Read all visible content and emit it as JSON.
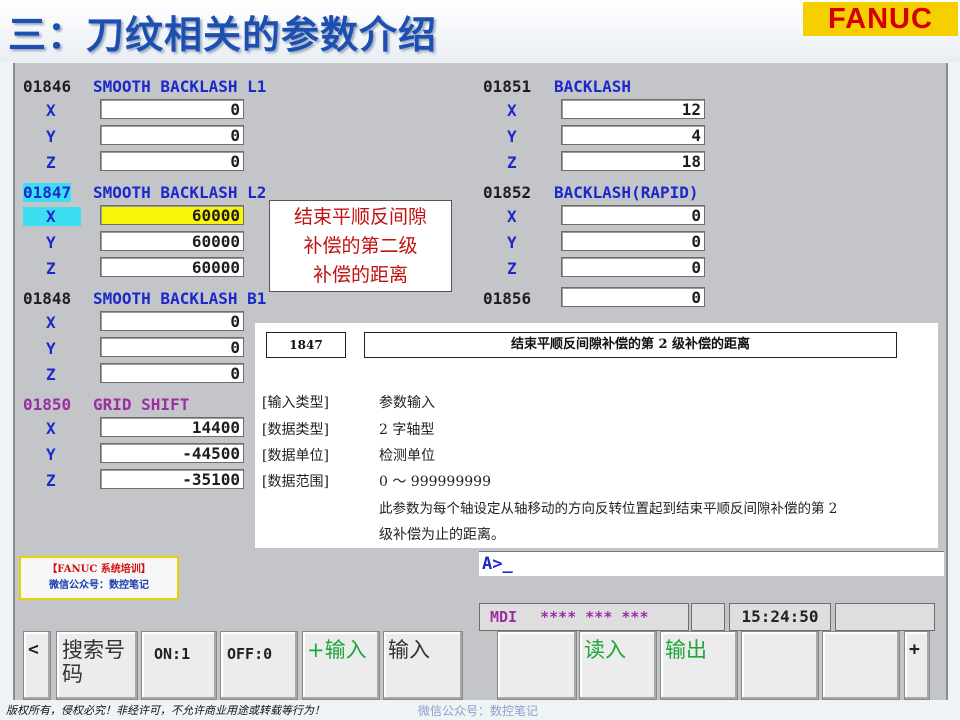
{
  "header": {
    "title": "三：刀纹相关的参数介绍",
    "logo": "FANUC"
  },
  "params": {
    "p1846": {
      "number": "01846",
      "name": "SMOOTH BACKLASH L1",
      "x": "0",
      "y": "0",
      "z": "0"
    },
    "p1847": {
      "number": "01847",
      "name": "SMOOTH BACKLASH L2",
      "x": "60000",
      "y": "60000",
      "z": "60000"
    },
    "p1848": {
      "number": "01848",
      "name": "SMOOTH BACKLASH B1",
      "x": "0",
      "y": "0",
      "z": "0"
    },
    "p1850": {
      "number": "01850",
      "name": "GRID SHIFT",
      "x": "14400",
      "y": "-44500",
      "z": "-35100"
    },
    "p1851": {
      "number": "01851",
      "name": "BACKLASH",
      "x": "12",
      "y": "4",
      "z": "18"
    },
    "p1852": {
      "number": "01852",
      "name": "BACKLASH(RAPID)",
      "x": "0",
      "y": "0",
      "z": "0"
    },
    "p1856": {
      "number": "01856",
      "value": "0"
    }
  },
  "axes": {
    "x": "X",
    "y": "Y",
    "z": "Z"
  },
  "note": {
    "line1": "结束平顺反间隙",
    "line2": "补偿的第二级",
    "line3": "补偿的距离"
  },
  "manual": {
    "param_no": "1847",
    "param_title": "结束平顺反间隙补偿的第 2 级补偿的距离",
    "rows": [
      {
        "label": "[输入类型]",
        "value": "参数输入"
      },
      {
        "label": "[数据类型]",
        "value": "2 字轴型"
      },
      {
        "label": "[数据单位]",
        "value": "检测单位"
      },
      {
        "label": "[数据范围]",
        "value": "0 ～ 999999999"
      }
    ],
    "desc1": "此参数为每个轴设定从轴移动的方向反转位置起到结束平顺反间隙补偿的第 2",
    "desc2": "级补偿为止的距离。"
  },
  "wechat_badge": {
    "line1": "【FANUC 系统培训】",
    "line2": "微信公众号：数控笔记"
  },
  "prompt": "A>_",
  "status": {
    "mode": "MDI",
    "stars": "**** *** ***",
    "time": "15:24:50"
  },
  "softkeys": {
    "left_arrow": "<",
    "search_line1": "搜索号",
    "search_line2": "码",
    "on1": "ON:1",
    "off0": "OFF:0",
    "plus_input": "+输入",
    "input": "输入",
    "read": "读入",
    "output": "输出",
    "plus": "+"
  },
  "footer": {
    "copyright": "版权所有，侵权必究！非经许可，不允许商业用途或转载等行为！",
    "wechat": "微信公众号：数控笔记"
  },
  "colors": {
    "title": "#1d4fb0",
    "logo_bg": "#f6cf00",
    "logo_text": "#d40000",
    "param_name": "#1a28cc",
    "highlight": "#3cdff2",
    "selected_field": "#f8f50b",
    "note_text": "#c11010",
    "softkey_green": "#1fa53a"
  }
}
